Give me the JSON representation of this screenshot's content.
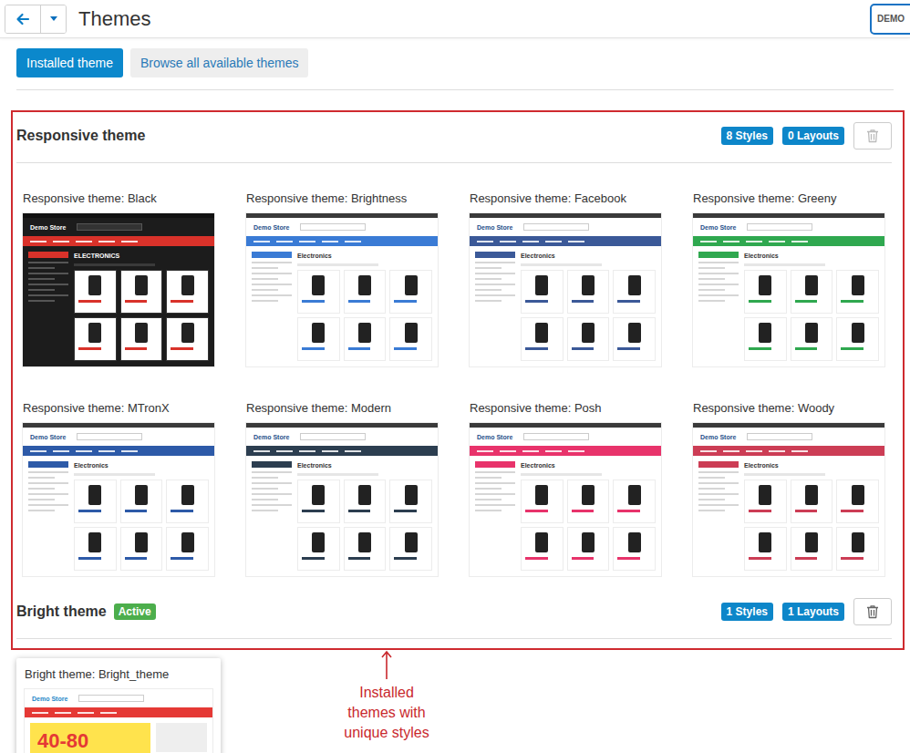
{
  "topbar": {
    "title": "Themes",
    "demo_button": "DEMO"
  },
  "tabs": [
    {
      "label": "Installed theme",
      "selected": true
    },
    {
      "label": "Browse all available themes",
      "selected": false
    }
  ],
  "active_label": "Active",
  "themes": [
    {
      "name": "Responsive theme",
      "active": false,
      "styles_badge": "8 Styles",
      "layouts_badge": "0 Layouts",
      "delete_disabled": true,
      "styles": [
        {
          "title": "Responsive theme: Black",
          "kind": "catalog",
          "logo": "Demo Store",
          "heading": "ELECTRONICS",
          "color": "#d9322a",
          "dark": true
        },
        {
          "title": "Responsive theme: Brightness",
          "kind": "catalog",
          "logo": "Demo Store",
          "heading": "Electronics",
          "color": "#3a7bd5",
          "dark": false
        },
        {
          "title": "Responsive theme: Facebook",
          "kind": "catalog",
          "logo": "Demo Store",
          "heading": "Electronics",
          "color": "#3b5998",
          "dark": false
        },
        {
          "title": "Responsive theme: Greeny",
          "kind": "catalog",
          "logo": "Demo Store",
          "heading": "Electronics",
          "color": "#2fa84f",
          "dark": false
        },
        {
          "title": "Responsive theme: MTronX",
          "kind": "catalog",
          "logo": "Demo Store",
          "heading": "Electronics",
          "color": "#2d5aa8",
          "dark": false
        },
        {
          "title": "Responsive theme: Modern",
          "kind": "catalog",
          "logo": "Demo Store",
          "heading": "Electronics",
          "color": "#2c3e50",
          "dark": false
        },
        {
          "title": "Responsive theme: Posh",
          "kind": "catalog",
          "logo": "Demo Store",
          "heading": "Electronics",
          "color": "#e8336b",
          "dark": false
        },
        {
          "title": "Responsive theme: Woody",
          "kind": "catalog",
          "logo": "Demo Store",
          "heading": "Electronics",
          "color": "#cc3d55",
          "dark": false
        }
      ]
    },
    {
      "name": "Bright theme",
      "active": true,
      "styles_badge": "1 Styles",
      "layouts_badge": "1 Layouts",
      "delete_disabled": false,
      "styles": [
        {
          "title": "Bright theme: Bright_theme",
          "kind": "promo",
          "logo": "Demo Store",
          "promo": "40-80",
          "color": "#e53935",
          "dark": false
        }
      ]
    }
  ],
  "annotation": {
    "lines": [
      "Installed",
      "themes with",
      "unique styles"
    ]
  }
}
